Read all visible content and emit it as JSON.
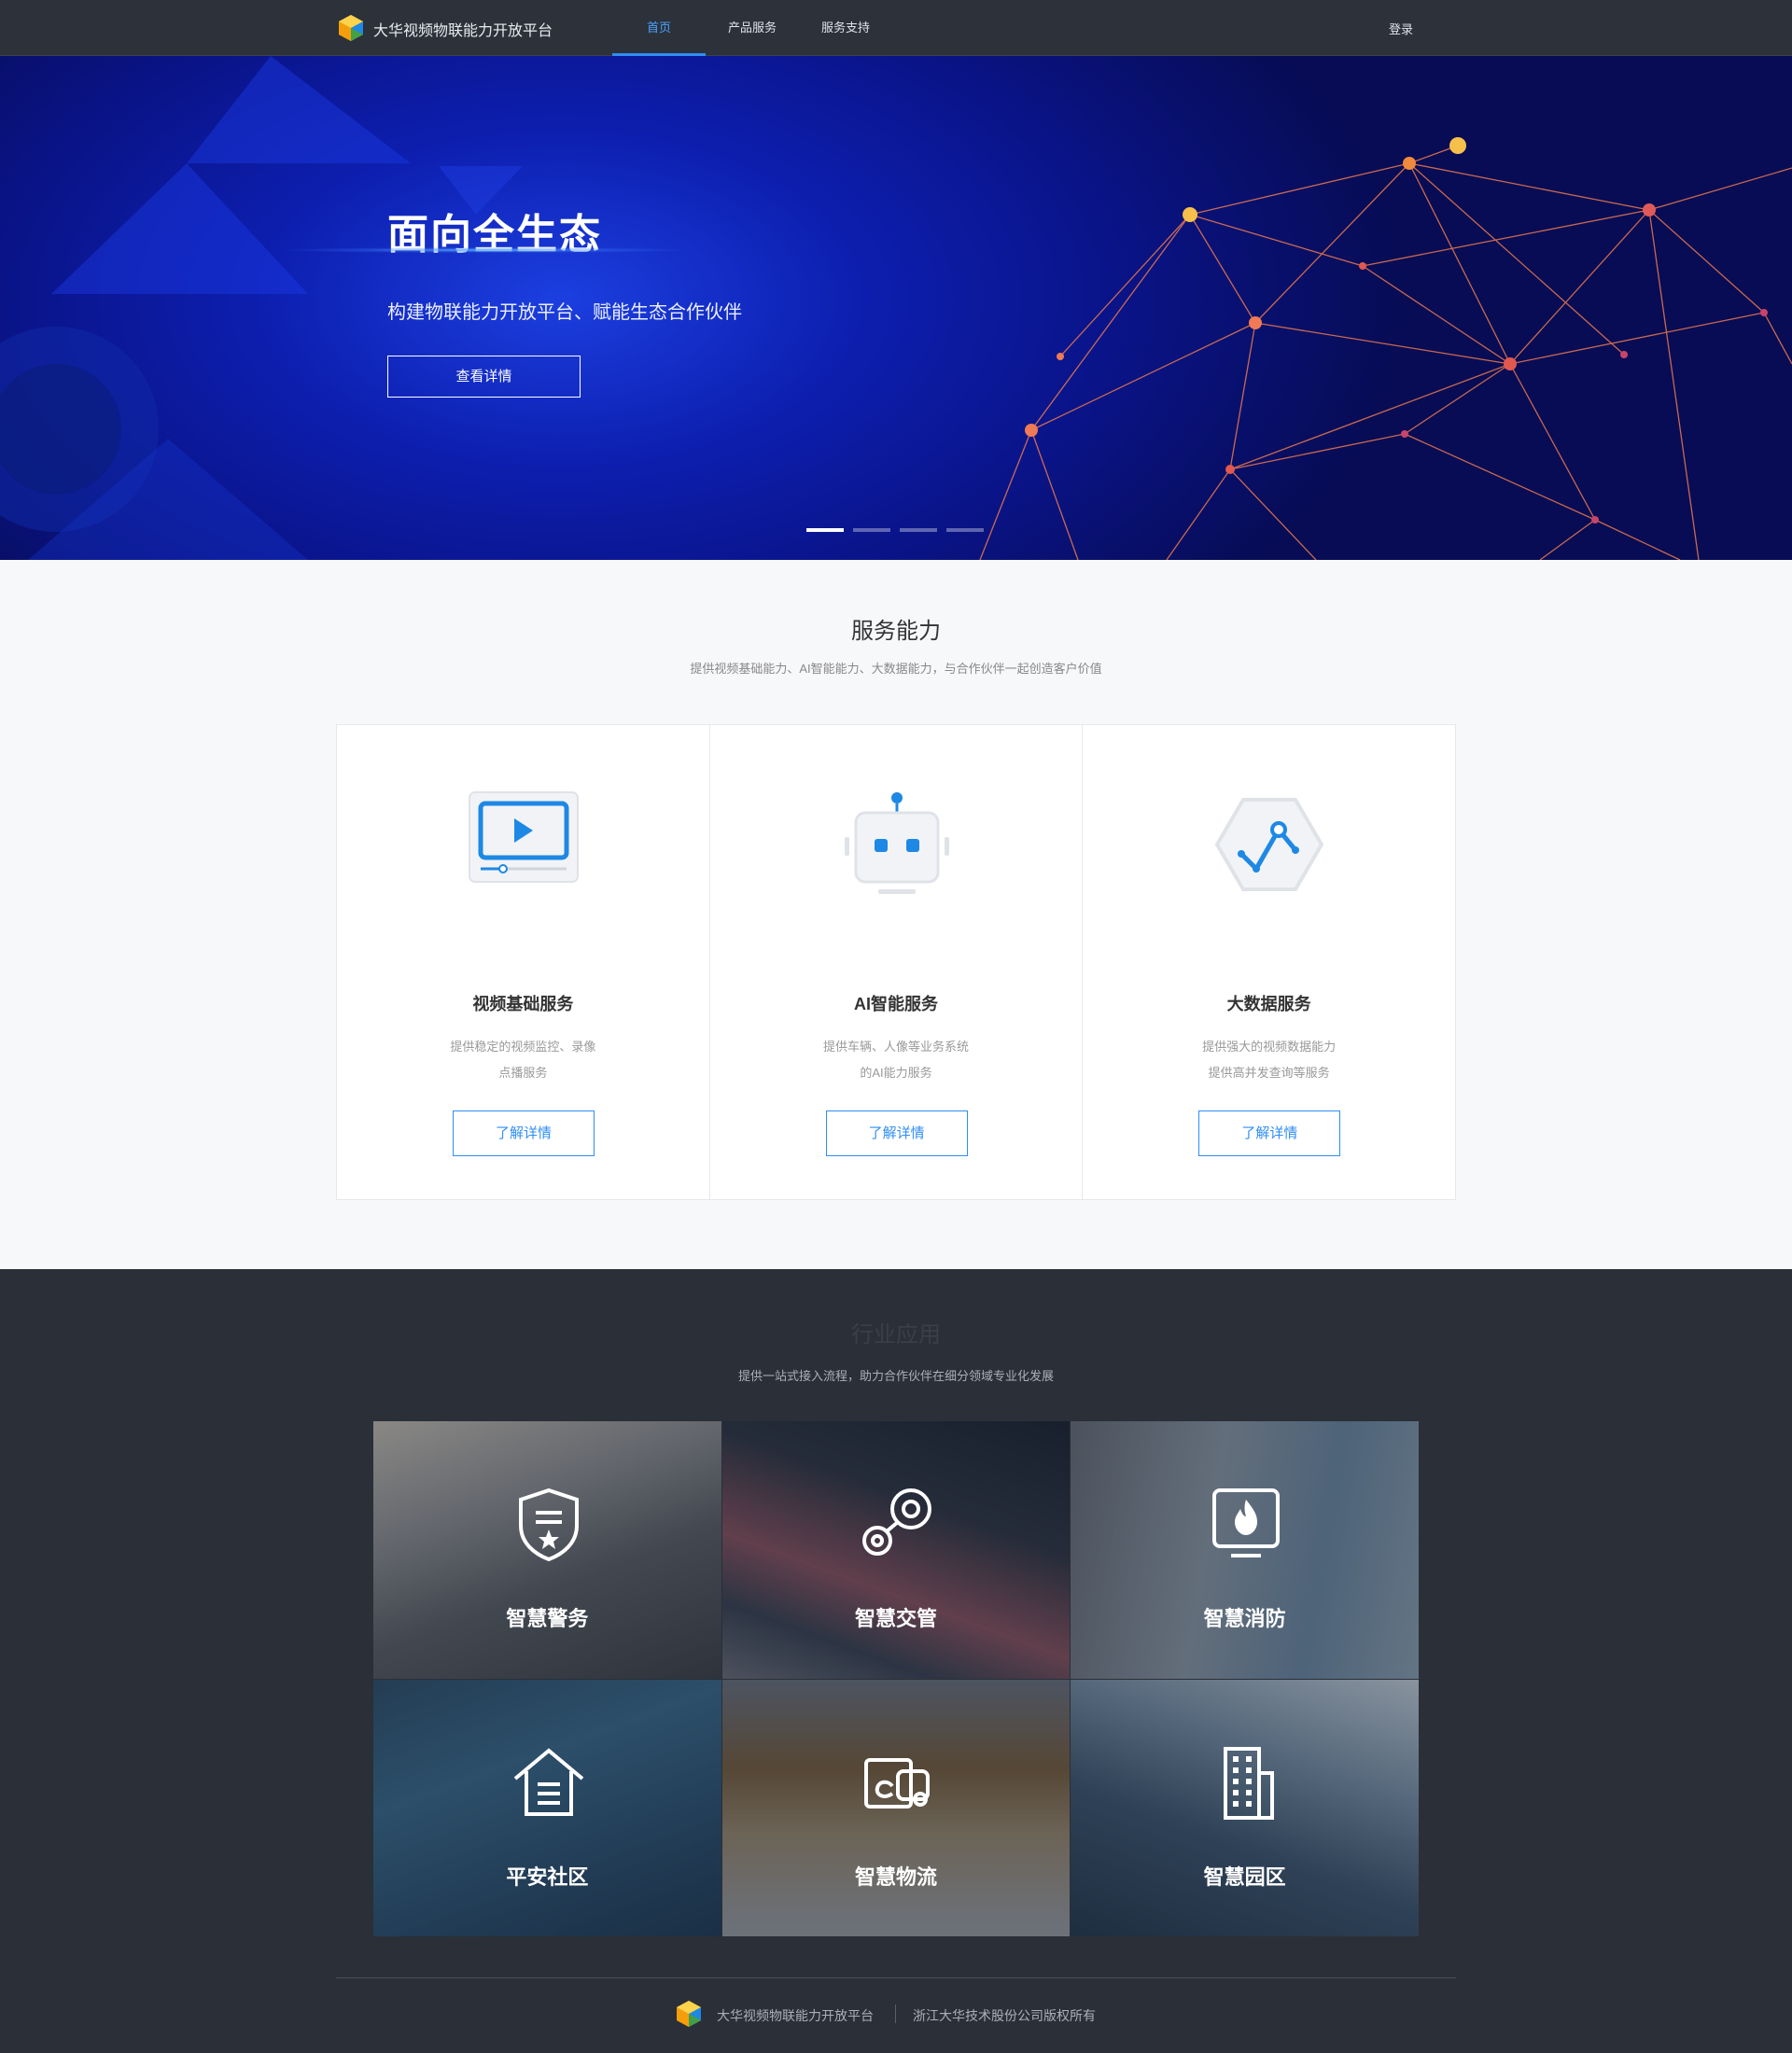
{
  "nav": {
    "brand": "大华视频物联能力开放平台",
    "menu": [
      {
        "label": "首页",
        "active": true
      },
      {
        "label": "产品服务",
        "active": false
      },
      {
        "label": "服务支持",
        "active": false
      }
    ],
    "login": "登录"
  },
  "hero": {
    "title": "面向全生态",
    "subtitle": "构建物联能力开放平台、赋能生态合作伙伴",
    "cta": "查看详情",
    "slides": 4,
    "active_slide": 1
  },
  "services": {
    "title": "服务能力",
    "subtitle": "提供视频基础能力、AI智能能力、大数据能力，与合作伙伴一起创造客户价值",
    "cards": [
      {
        "icon": "video-play-icon",
        "name": "视频基础服务",
        "desc1": "提供稳定的视频监控、录像",
        "desc2": "点播服务",
        "button": "了解详情"
      },
      {
        "icon": "robot-icon",
        "name": "AI智能服务",
        "desc1": "提供车辆、人像等业务系统",
        "desc2": "的AI能力服务",
        "button": "了解详情"
      },
      {
        "icon": "data-chart-icon",
        "name": "大数据服务",
        "desc1": "提供强大的视频数据能力",
        "desc2": "提供高并发查询等服务",
        "button": "了解详情"
      }
    ]
  },
  "industry": {
    "title": "行业应用",
    "subtitle": "提供一站式接入流程，助力合作伙伴在细分领域专业化发展",
    "tiles": [
      {
        "icon": "police-shield-icon",
        "label": "智慧警务"
      },
      {
        "icon": "traffic-route-icon",
        "label": "智慧交管"
      },
      {
        "icon": "fire-monitor-icon",
        "label": "智慧消防"
      },
      {
        "icon": "house-icon",
        "label": "平安社区"
      },
      {
        "icon": "delivery-truck-icon",
        "label": "智慧物流"
      },
      {
        "icon": "building-icon",
        "label": "智慧园区"
      }
    ]
  },
  "footer": {
    "brand": "大华视频物联能力开放平台",
    "copyright": "浙江大华技术股份公司版权所有"
  },
  "colors": {
    "accent": "#2f8ef5",
    "nav_bg": "#2c313a",
    "hero_bg": "#0d1fb0",
    "industry_bg": "#2b2f37"
  }
}
